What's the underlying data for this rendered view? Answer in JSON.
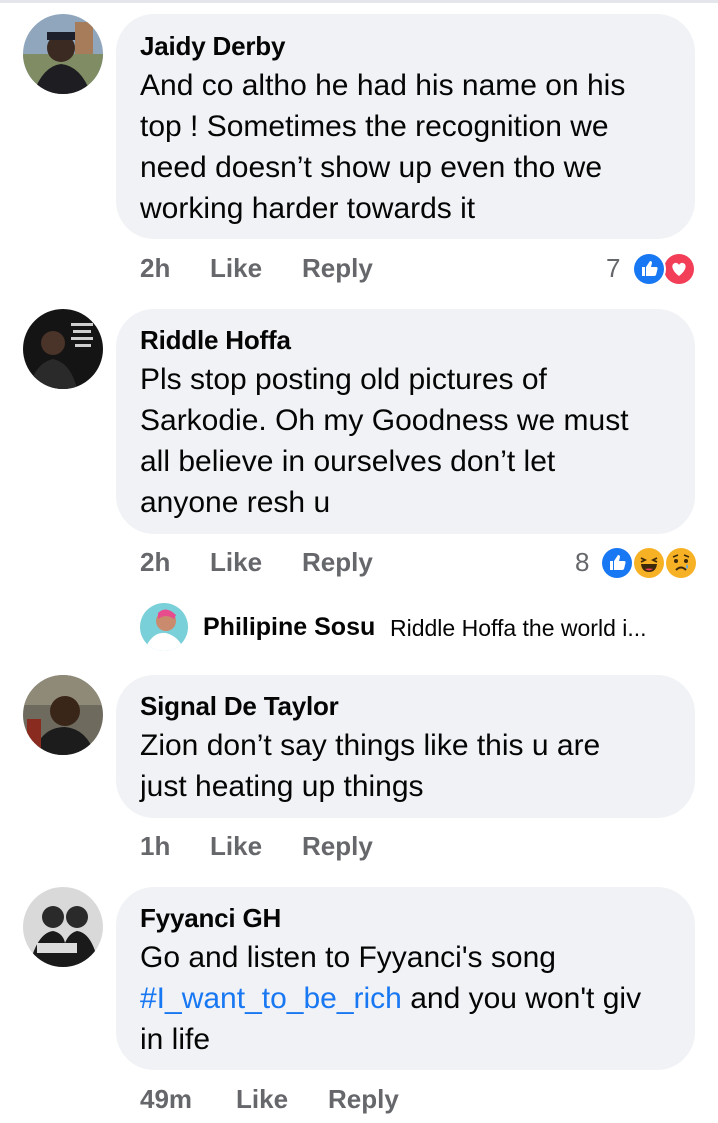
{
  "comments": [
    {
      "author": "Jaidy Derby",
      "lines": [
        "And co altho he had his name on his",
        "top ! Sometimes the recognition we",
        "need doesn’t show up even tho we",
        "working harder towards it"
      ],
      "time": "2h",
      "like_label": "Like",
      "reply_label": "Reply",
      "reaction_count": "7",
      "reactions": [
        "like-icon",
        "love-icon"
      ]
    },
    {
      "author": "Riddle Hoffa",
      "lines": [
        "Pls stop posting old pictures of",
        "Sarkodie. Oh my Goodness we must",
        "all believe in ourselves don’t let",
        "anyone resh u"
      ],
      "time": "2h",
      "like_label": "Like",
      "reply_label": "Reply",
      "reaction_count": "8",
      "reactions": [
        "like-icon",
        "haha-icon",
        "sad-icon"
      ],
      "reply_preview": {
        "author": "Philipine Sosu",
        "text": "Riddle Hoffa the world i..."
      }
    },
    {
      "author": "Signal De Taylor",
      "lines": [
        "Zion don’t say things like this u are",
        "just heating up things"
      ],
      "time": "1h",
      "like_label": "Like",
      "reply_label": "Reply"
    },
    {
      "author": "Fyyanci GH",
      "lines": [
        "Go and listen to Fyyanci's song",
        " and you won't giv",
        "in life"
      ],
      "hashtag": "#I_want_to_be_rich",
      "time": "49m",
      "like_label": "Like",
      "reply_label": "Reply"
    }
  ],
  "colors": {
    "bubble": "#f0f2f5",
    "meta": "#65676b",
    "link": "#1877f2",
    "like": "#1877f2",
    "love": "#f33e58"
  }
}
